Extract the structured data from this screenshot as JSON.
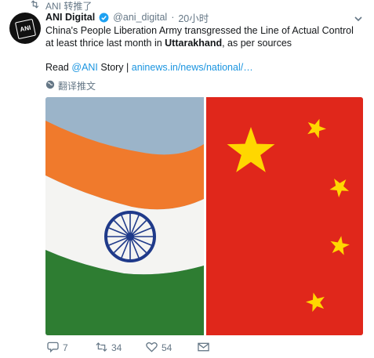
{
  "retweet_context": {
    "text": "ANI 转推了",
    "icon": "retweet-icon"
  },
  "tweet": {
    "author_name": "ANI Digital",
    "verified": true,
    "handle": "@ani_digital",
    "separator": "·",
    "time": "20小时",
    "text_part1": "China's People Liberation Army transgressed the Line of Actual Control at least thrice last month in ",
    "text_bold": "Uttarakhand",
    "text_part2": ", as per sources",
    "read_prefix": "Read ",
    "mention_at": "@",
    "mention": "ANI",
    "story_text": " Story | ",
    "link": "aninews.in/news/national/…",
    "translate_label": "翻译推文",
    "avatar_text": "ANI"
  },
  "media": {
    "description_icon": "india-china-flags-image",
    "colors": {
      "saffron": "#f07a2c",
      "india_white": "#f4f4f2",
      "india_green": "#2e7d32",
      "chakra": "#1f3a8a",
      "china_red": "#e0271b",
      "star_yellow": "#ffd700"
    }
  },
  "actions": {
    "reply_count": "7",
    "retweet_count": "34",
    "like_count": "54"
  },
  "colors": {
    "text_primary": "#14171a",
    "text_secondary": "#657786",
    "link": "#1b95e0",
    "verified": "#1da1f2"
  }
}
